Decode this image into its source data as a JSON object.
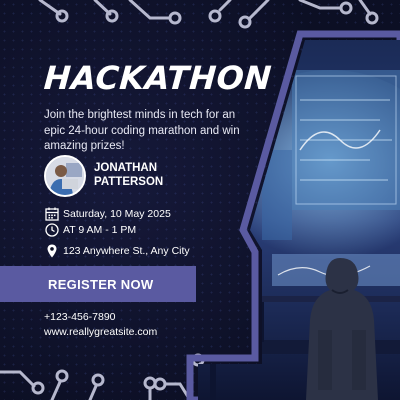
{
  "title": "HACKATHON",
  "description": "Join the brightest minds in tech for an epic 24-hour coding marathon and win amazing prizes!",
  "host": {
    "name": "JONATHAN\nPATTERSON"
  },
  "details": {
    "date": "Saturday, 10 May 2025",
    "time": "AT 9 AM - 1 PM",
    "location": "123 Anywhere St., Any City"
  },
  "cta_label": "REGISTER NOW",
  "contact": {
    "phone": "+123-456-7890",
    "website": "www.reallygreatsite.com"
  },
  "colors": {
    "background": "#0c0f24",
    "accent": "#5a5aa1",
    "text": "#ffffff"
  },
  "icons": [
    "calendar-icon",
    "clock-icon",
    "location-pin-icon"
  ]
}
